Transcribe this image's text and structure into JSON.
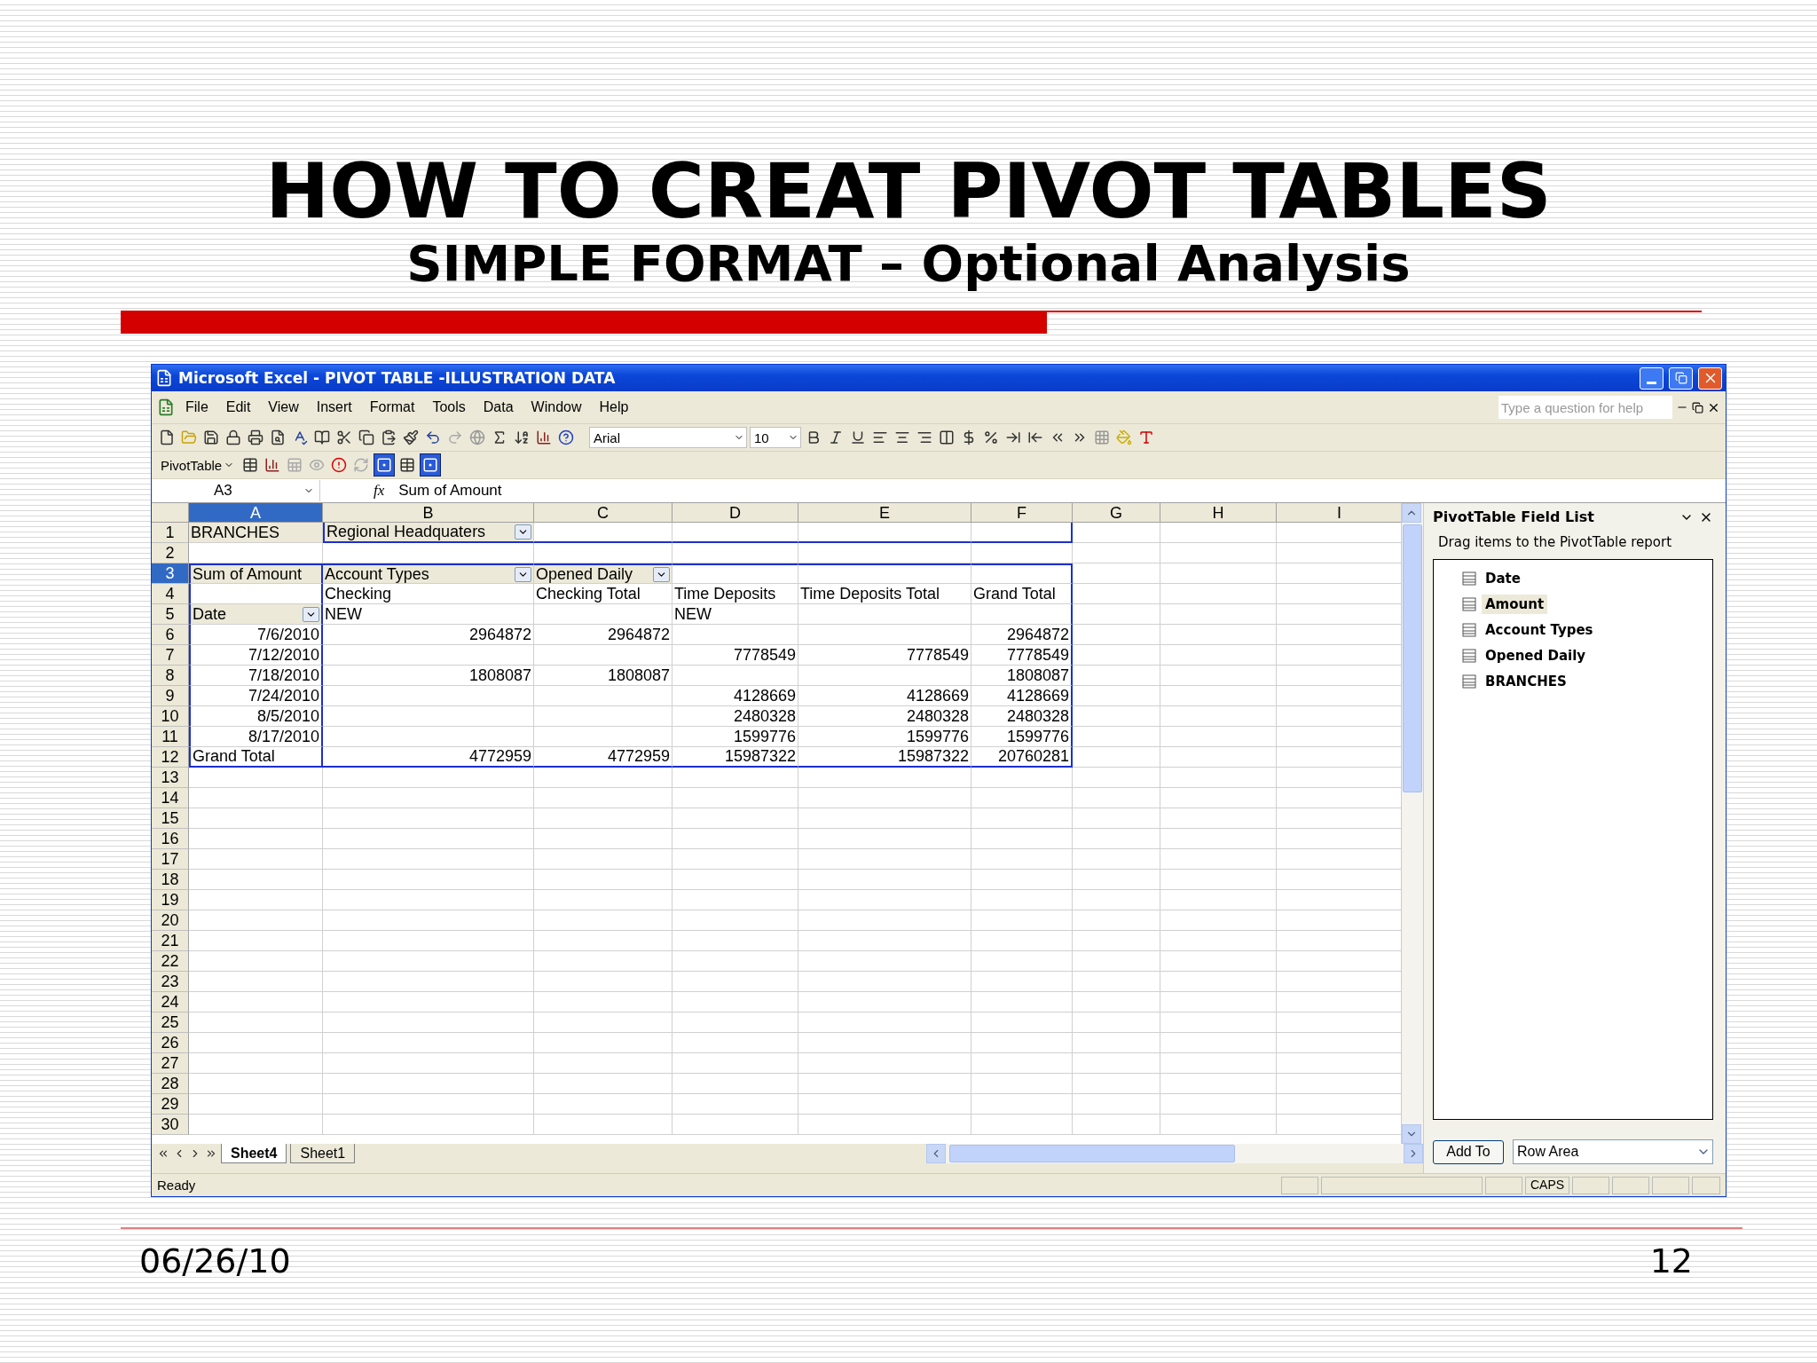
{
  "slide": {
    "title": "HOW TO CREAT PIVOT TABLES",
    "subtitle": "SIMPLE FORMAT – Optional Analysis",
    "date": "06/26/10",
    "page_number": "12"
  },
  "window": {
    "title": "Microsoft Excel - PIVOT TABLE -ILLUSTRATION DATA"
  },
  "menu": [
    "File",
    "Edit",
    "View",
    "Insert",
    "Format",
    "Tools",
    "Data",
    "Window",
    "Help"
  ],
  "help_box": {
    "placeholder": "Type a question for help"
  },
  "formatting": {
    "font": "Arial",
    "size": "10"
  },
  "pivot_toolbar": {
    "label": "PivotTable"
  },
  "formula_bar": {
    "name_box": "A3",
    "function_label": "fx",
    "formula": "Sum of Amount"
  },
  "columns": [
    {
      "label": "A",
      "selected": true
    },
    {
      "label": "B",
      "selected": false
    },
    {
      "label": "C",
      "selected": false
    },
    {
      "label": "D",
      "selected": false
    },
    {
      "label": "E",
      "selected": false
    },
    {
      "label": "F",
      "selected": false
    },
    {
      "label": "G",
      "selected": false
    },
    {
      "label": "H",
      "selected": false
    },
    {
      "label": "I",
      "selected": false
    }
  ],
  "rows": [
    {
      "number": "1",
      "selected": false,
      "cells": [
        {
          "text": "BRANCHES",
          "kind": "field"
        },
        {
          "text": "Regional Headquaters",
          "kind": "dropdown"
        }
      ]
    },
    {
      "number": "2",
      "selected": false,
      "cells": []
    },
    {
      "number": "3",
      "selected": true,
      "cells": [
        {
          "text": "Sum of Amount",
          "kind": "field"
        },
        {
          "text": "Account Types",
          "kind": "dropdown"
        },
        {
          "text": "Opened Daily",
          "kind": "dropdown"
        }
      ]
    },
    {
      "number": "4",
      "selected": false,
      "cells": [
        {
          "text": "",
          "kind": "text"
        },
        {
          "text": "Checking",
          "kind": "text"
        },
        {
          "text": "Checking Total",
          "kind": "text"
        },
        {
          "text": "Time Deposits",
          "kind": "text"
        },
        {
          "text": "Time Deposits Total",
          "kind": "text"
        },
        {
          "text": "Grand Total",
          "kind": "text"
        }
      ]
    },
    {
      "number": "5",
      "selected": false,
      "cells": [
        {
          "text": "Date",
          "kind": "dropdown"
        },
        {
          "text": "NEW",
          "kind": "text"
        },
        {
          "text": "",
          "kind": "text"
        },
        {
          "text": "NEW",
          "kind": "text"
        }
      ]
    },
    {
      "number": "6",
      "selected": false,
      "cells": [
        {
          "text": "7/6/2010",
          "kind": "number"
        },
        {
          "text": "2964872",
          "kind": "number"
        },
        {
          "text": "2964872",
          "kind": "number"
        },
        {
          "text": "",
          "kind": "number"
        },
        {
          "text": "",
          "kind": "number"
        },
        {
          "text": "2964872",
          "kind": "number"
        }
      ]
    },
    {
      "number": "7",
      "selected": false,
      "cells": [
        {
          "text": "7/12/2010",
          "kind": "number"
        },
        {
          "text": "",
          "kind": "number"
        },
        {
          "text": "",
          "kind": "number"
        },
        {
          "text": "7778549",
          "kind": "number"
        },
        {
          "text": "7778549",
          "kind": "number"
        },
        {
          "text": "7778549",
          "kind": "number"
        }
      ]
    },
    {
      "number": "8",
      "selected": false,
      "cells": [
        {
          "text": "7/18/2010",
          "kind": "number"
        },
        {
          "text": "1808087",
          "kind": "number"
        },
        {
          "text": "1808087",
          "kind": "number"
        },
        {
          "text": "",
          "kind": "number"
        },
        {
          "text": "",
          "kind": "number"
        },
        {
          "text": "1808087",
          "kind": "number"
        }
      ]
    },
    {
      "number": "9",
      "selected": false,
      "cells": [
        {
          "text": "7/24/2010",
          "kind": "number"
        },
        {
          "text": "",
          "kind": "number"
        },
        {
          "text": "",
          "kind": "number"
        },
        {
          "text": "4128669",
          "kind": "number"
        },
        {
          "text": "4128669",
          "kind": "number"
        },
        {
          "text": "4128669",
          "kind": "number"
        }
      ]
    },
    {
      "number": "10",
      "selected": false,
      "cells": [
        {
          "text": "8/5/2010",
          "kind": "number"
        },
        {
          "text": "",
          "kind": "number"
        },
        {
          "text": "",
          "kind": "number"
        },
        {
          "text": "2480328",
          "kind": "number"
        },
        {
          "text": "2480328",
          "kind": "number"
        },
        {
          "text": "2480328",
          "kind": "number"
        }
      ]
    },
    {
      "number": "11",
      "selected": false,
      "cells": [
        {
          "text": "8/17/2010",
          "kind": "number"
        },
        {
          "text": "",
          "kind": "number"
        },
        {
          "text": "",
          "kind": "number"
        },
        {
          "text": "1599776",
          "kind": "number"
        },
        {
          "text": "1599776",
          "kind": "number"
        },
        {
          "text": "1599776",
          "kind": "number"
        }
      ]
    },
    {
      "number": "12",
      "selected": false,
      "cells": [
        {
          "text": "Grand Total",
          "kind": "text"
        },
        {
          "text": "4772959",
          "kind": "number"
        },
        {
          "text": "4772959",
          "kind": "number"
        },
        {
          "text": "15987322",
          "kind": "number"
        },
        {
          "text": "15987322",
          "kind": "number"
        },
        {
          "text": "20760281",
          "kind": "number"
        }
      ]
    },
    {
      "number": "13",
      "selected": false,
      "cells": []
    },
    {
      "number": "14",
      "selected": false,
      "cells": []
    },
    {
      "number": "15",
      "selected": false,
      "cells": []
    },
    {
      "number": "16",
      "selected": false,
      "cells": []
    },
    {
      "number": "17",
      "selected": false,
      "cells": []
    },
    {
      "number": "18",
      "selected": false,
      "cells": []
    },
    {
      "number": "19",
      "selected": false,
      "cells": []
    },
    {
      "number": "20",
      "selected": false,
      "cells": []
    },
    {
      "number": "21",
      "selected": false,
      "cells": []
    },
    {
      "number": "22",
      "selected": false,
      "cells": []
    },
    {
      "number": "23",
      "selected": false,
      "cells": []
    },
    {
      "number": "24",
      "selected": false,
      "cells": []
    },
    {
      "number": "25",
      "selected": false,
      "cells": []
    },
    {
      "number": "26",
      "selected": false,
      "cells": []
    },
    {
      "number": "27",
      "selected": false,
      "cells": []
    },
    {
      "number": "28",
      "selected": false,
      "cells": []
    },
    {
      "number": "29",
      "selected": false,
      "cells": []
    },
    {
      "number": "30",
      "selected": false,
      "cells": []
    }
  ],
  "sheet_tabs": [
    {
      "label": "Sheet4",
      "selected": true
    },
    {
      "label": "Sheet1",
      "selected": false
    }
  ],
  "status_bar": {
    "status": "Ready",
    "indicator": "CAPS"
  },
  "field_list": {
    "title": "PivotTable Field List",
    "instruction": "Drag items to the PivotTable report",
    "fields": [
      {
        "label": "Date",
        "selected": false
      },
      {
        "label": "Amount",
        "selected": true
      },
      {
        "label": "Account Types",
        "selected": false
      },
      {
        "label": "Opened Daily",
        "selected": false
      },
      {
        "label": "BRANCHES",
        "selected": false
      }
    ],
    "add_button": "Add To",
    "area": "Row Area"
  }
}
